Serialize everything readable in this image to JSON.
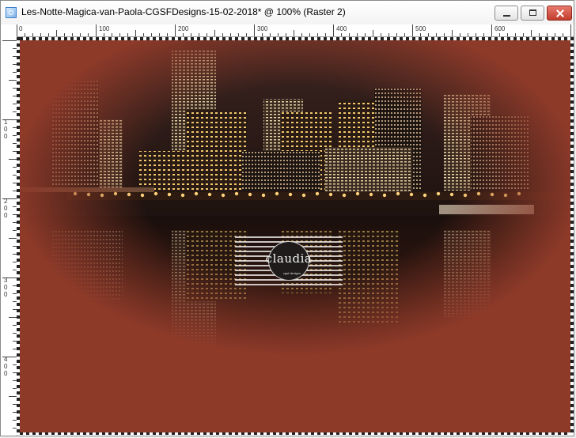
{
  "window": {
    "title": "Les-Notte-Magica-van-Paola-CGSFDesigns-15-02-2018* @ 100% (Raster 2)",
    "app_icon": "psp-image-icon",
    "buttons": [
      "minimize-icon",
      "maximize-icon",
      "close-icon"
    ]
  },
  "ruler": {
    "horizontal_labels": [
      "0",
      "100",
      "200",
      "300",
      "400",
      "500",
      "600"
    ],
    "vertical_labels": [
      "1\n0\n0",
      "2\n0\n0",
      "3\n0\n0",
      "4\n0\n0"
    ]
  },
  "canvas": {
    "background_color": "#8e3a29",
    "image_subject": "night city skyline reflected in river",
    "watermark": {
      "text": "claudia",
      "subtext": "cgsf designs"
    }
  }
}
